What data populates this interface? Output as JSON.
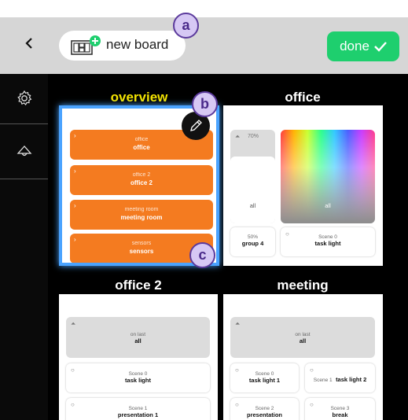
{
  "topbar": {
    "back_icon": "chevron-left-icon",
    "new_board_label": "new board",
    "done_label": "done",
    "done_icon": "check-icon"
  },
  "sidebar": {
    "settings_icon": "gear-icon",
    "scenes_icon": "lamp-icon"
  },
  "boards": {
    "overview": {
      "title": "overview",
      "edit_icon": "pencil-icon",
      "items": [
        {
          "small": "office",
          "label": "office"
        },
        {
          "small": "office 2",
          "label": "office 2"
        },
        {
          "small": "meeting room",
          "label": "meeting room"
        },
        {
          "small": "sensors",
          "label": "sensors"
        }
      ]
    },
    "office": {
      "title": "office",
      "dimmer_value": "70%",
      "dimmer_label": "all",
      "color_label": "all",
      "group_value": "50%",
      "group_label": "group 4",
      "scene_small": "Scene 0",
      "scene_label": "task light"
    },
    "office2": {
      "title": "office 2",
      "onlast_small": "on last",
      "onlast_label": "all",
      "scene0_small": "Scene 0",
      "scene0_label": "task light",
      "scene1_small": "Scene 1",
      "scene1_label": "presentation 1"
    },
    "meeting": {
      "title": "meeting",
      "onlast_small": "on last",
      "onlast_label": "all",
      "scene0_small": "Scene 0",
      "scene0_label": "task light 1",
      "scene1_small": "Scene 1",
      "scene1_label": "task light 2",
      "scene2_small": "Scene 2",
      "scene2_label": "presentation",
      "scene3_small": "Scene 3",
      "scene3_label": "break"
    }
  },
  "callouts": {
    "a": "a",
    "b": "b",
    "c": "c"
  },
  "colors": {
    "accent_title": "#f5e400",
    "done_green": "#1ecf6e",
    "orange": "#f47b20",
    "selection": "#4aa3ff"
  }
}
